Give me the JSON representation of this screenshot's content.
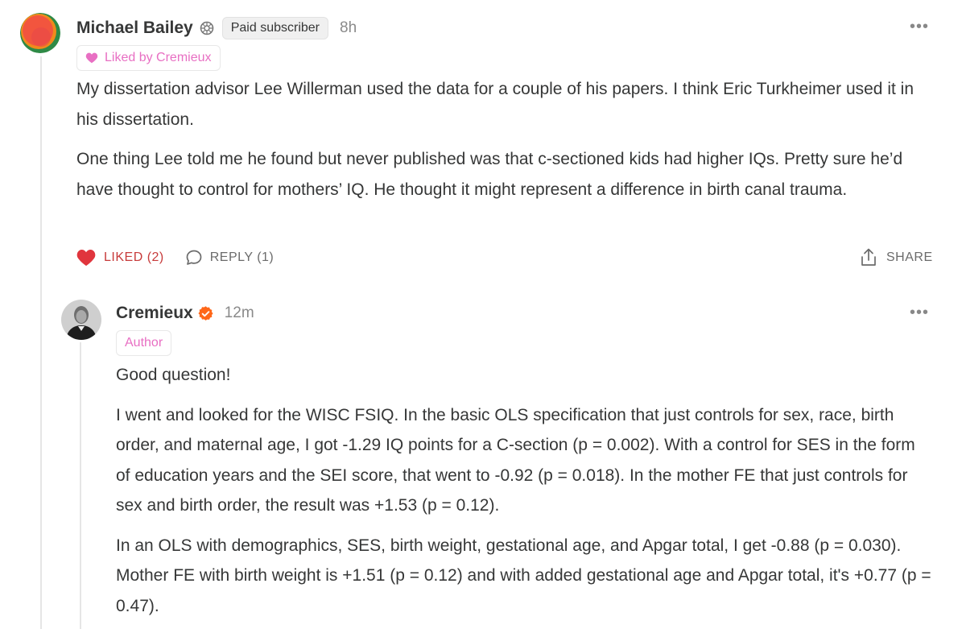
{
  "comment": {
    "author": "Michael Bailey",
    "badge": "Paid subscriber",
    "time": "8h",
    "liked_by": "Liked by Cremieux",
    "paragraphs": [
      "My dissertation advisor Lee Willerman used the data for a couple of his papers. I think Eric Turkheimer used it in his dissertation.",
      "One thing Lee told me he found but never published was that c-sectioned kids had higher IQs. Pretty sure he’d have thought to control for mothers’ IQ. He thought it might represent a difference in birth canal trauma."
    ],
    "actions": {
      "liked": "LIKED (2)",
      "reply": "REPLY (1)",
      "share": "SHARE"
    },
    "more": "•••"
  },
  "reply": {
    "author": "Cremieux",
    "time": "12m",
    "role": "Author",
    "paragraphs": [
      "Good question!",
      "I went and looked for the WISC FSIQ. In the basic OLS specification that just controls for sex, race, birth order, and maternal age, I got -1.29 IQ points for a C-section (p = 0.002). With a control for SES in the form of education years and the SEI score, that went to -0.92 (p = 0.018). In the mother FE that just controls for sex and birth order, the result was +1.53 (p = 0.12).",
      "In an OLS with demographics, SES, birth weight, gestational age, and Apgar total, I get -0.88 (p = 0.030). Mother FE with birth weight is +1.51 (p = 0.12) and with added gestational age and Apgar total, it's +0.77 (p = 0.47)."
    ],
    "more": "•••"
  },
  "colors": {
    "accent_like": "#c73b3b",
    "pink": "#e86fc3",
    "verified": "#ff6719"
  }
}
